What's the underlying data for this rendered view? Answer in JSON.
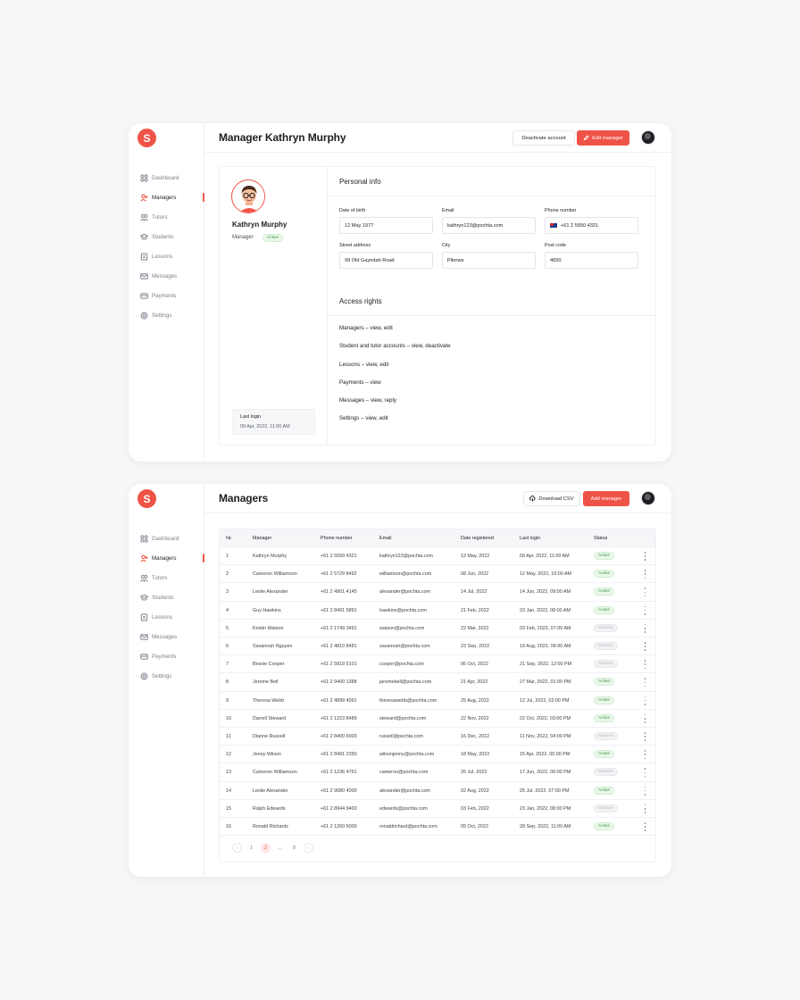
{
  "app": {
    "logo": "S",
    "brand_color": "#ef5347"
  },
  "sidebar": {
    "items": [
      {
        "label": "Dashboard",
        "icon": "grid-icon"
      },
      {
        "label": "Managers",
        "icon": "user-plus-icon",
        "active": true
      },
      {
        "label": "Tutors",
        "icon": "users-icon"
      },
      {
        "label": "Students",
        "icon": "graduation-cap-icon"
      },
      {
        "label": "Lessons",
        "icon": "book-icon"
      },
      {
        "label": "Messages",
        "icon": "mail-icon"
      },
      {
        "label": "Payments",
        "icon": "card-icon"
      },
      {
        "label": "Settings",
        "icon": "gear-icon"
      }
    ]
  },
  "profile_page": {
    "title": "Manager Kathryn Murphy",
    "deactivate_label": "Deactivate account",
    "edit_label": "Edit manager",
    "name": "Kathryn Murphy",
    "role": "Manager",
    "status": "Active",
    "last_login_label": "Last login",
    "last_login_value": "09 Apr, 2022, 11:00 AM",
    "personal_info_title": "Personal info",
    "fields": {
      "dob": {
        "label": "Date of birth",
        "value": "12 May 1977"
      },
      "email": {
        "label": "Email",
        "value": "kathryn123@pochta.com"
      },
      "phone": {
        "label": "Phone number",
        "value": "+61 2 5550 4321"
      },
      "street": {
        "label": "Street address",
        "value": "99 Old Gayndah Road"
      },
      "city": {
        "label": "City",
        "value": "Pilerwa"
      },
      "post": {
        "label": "Post code",
        "value": "4650"
      }
    },
    "access_title": "Access rights",
    "access_rights": [
      "Managers – view, edit",
      "Student and tutor accounts – view, deactivate",
      "Lessons – view, edit",
      "Payments – view",
      "Messages – view, reply",
      "Settings – view, edit"
    ]
  },
  "managers_page": {
    "title": "Managers",
    "download_label": "Download CSV",
    "add_label": "Add manager",
    "columns": [
      "№",
      "Manager",
      "Phone number",
      "Email",
      "Date registered",
      "Last login",
      "Status"
    ],
    "rows": [
      [
        "1",
        "Kathryn Murphy",
        "+61 2 5550 4321",
        "kathryn123@pochta.com",
        "12 May, 2022",
        "09 Apr, 2022, 11:00 AM",
        "Active"
      ],
      [
        "2",
        "Cameron Williamson",
        "+61 2 5729 8492",
        "williamson@pochta.com",
        "08 Jun, 2022",
        "12 May, 2022, 10:00 AM",
        "Active"
      ],
      [
        "3",
        "Leslie Alexander",
        "+61 2 4901 4145",
        "alexander@pochta.com",
        "14 Jul, 2022",
        "14 Jun, 2022, 09:00 AM",
        "Active"
      ],
      [
        "4",
        "Guy Hawkins",
        "+61 2 8491 5891",
        "hawkins@pochta.com",
        "21 Feb, 2022",
        "23 Jan, 2022, 08:00 AM",
        "Active"
      ],
      [
        "5",
        "Kristin Watson",
        "+61 2 1749 3491",
        "watson@pochta.com",
        "22 Mar, 2022",
        "03 Feb, 2022, 07:00 AM",
        "Inactive"
      ],
      [
        "6",
        "Savannah Nguyen",
        "+61 2 4810 8481",
        "savannah@pochta.com",
        "23 Sep, 2022",
        "19 Aug, 2022, 06:00 AM",
        "Inactive"
      ],
      [
        "7",
        "Bessie Cooper",
        "+61 2 5819 5101",
        "cooper@pochta.com",
        "06 Oct, 2022",
        "21 Sep, 2022, 12:00 PM",
        "Inactive"
      ],
      [
        "8",
        "Jerome Bell",
        "+61 2 9400 1388",
        "jaromebell@pochta.com",
        "21 Apr, 2022",
        "27 Mar, 2022, 01:00 PM",
        "Active"
      ],
      [
        "9",
        "Theresa Webb",
        "+61 2 4899 4091",
        "theresawebb@pochta.com",
        "25 Aug, 2022",
        "12 Jul, 2022, 02:00 PM",
        "Active"
      ],
      [
        "10",
        "Darrell Steward",
        "+61 2 1223 8489",
        "steward@pochta.com",
        "22 Nov, 2022",
        "22 Oct, 2022, 03:00 PM",
        "Active"
      ],
      [
        "11",
        "Dianne Russell",
        "+61 2 8400 6000",
        "russell@pochta.com",
        "16 Dec, 2022",
        "11 Nov, 2022, 04:00 PM",
        "Inactive"
      ],
      [
        "12",
        "Jenny Wilson",
        "+61 2 8491 2350",
        "wilsonjenny@pochta.com",
        "18 May, 2022",
        "15 Apr, 2022, 05:00 PM",
        "Active"
      ],
      [
        "13",
        "Cameron Williamson",
        "+61 2 1236 4761",
        "cameron@pochta.com",
        "26 Jul, 2022",
        "17 Jun, 2022, 06:00 PM",
        "Inactive"
      ],
      [
        "14",
        "Leslie Alexander",
        "+61 2 9080 4000",
        "alexander@pochta.com",
        "02 Aug, 2022",
        "25 Jul, 2022, 07:00 PM",
        "Active"
      ],
      [
        "15",
        "Ralph Edwards",
        "+61 2 8944 9400",
        "edwards@pochta.com",
        "03 Feb, 2022",
        "23 Jan, 2022, 08:00 PM",
        "Inactive"
      ],
      [
        "16",
        "Ronald Richards",
        "+61 2 1200 5000",
        "ronaldrichard@pochta.com",
        "05 Oct, 2022",
        "28 Sep, 2022, 11:00 AM",
        "Active"
      ]
    ],
    "pagination": {
      "prev": "‹",
      "pages": [
        "1",
        "2",
        "...",
        "8"
      ],
      "current": "2",
      "next": "›"
    }
  }
}
